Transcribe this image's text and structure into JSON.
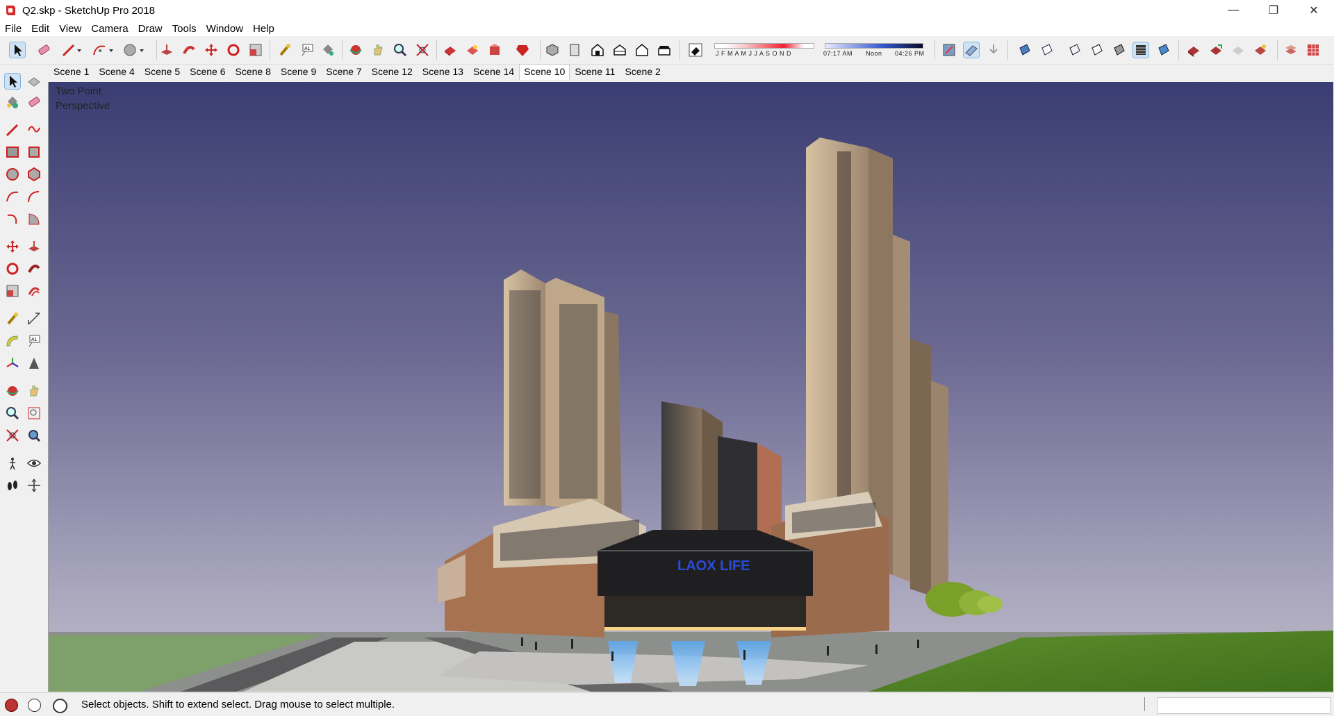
{
  "window": {
    "title": "Q2.skp - SketchUp Pro 2018",
    "controls": [
      "minimize-icon",
      "restore-icon",
      "close-icon"
    ]
  },
  "menu": [
    "File",
    "Edit",
    "View",
    "Camera",
    "Draw",
    "Tools",
    "Window",
    "Help"
  ],
  "shadows": {
    "months": "J F M A M J J A S O N D",
    "time_start": "07:17 AM",
    "time_mid": "Noon",
    "time_end": "04:26 PM"
  },
  "scenes": {
    "tabs": [
      "Scene 1",
      "Scene 4",
      "Scene 5",
      "Scene 6",
      "Scene 8",
      "Scene 9",
      "Scene 7",
      "Scene 12",
      "Scene 13",
      "Scene 14",
      "Scene 10",
      "Scene 11",
      "Scene 2"
    ],
    "active": "Scene 10"
  },
  "viewport": {
    "camera_label": "Two Point\nPerspective",
    "sign_text": "LAOX LIFE"
  },
  "status": {
    "message": "Select objects. Shift to extend select. Drag mouse to select multiple.",
    "measurements_value": ""
  },
  "colors": {
    "sky_top": "#3c3f73",
    "sky_bottom": "#b3b0c2",
    "grass": "#5a8a2a",
    "brick": "#8b5a42",
    "sign_blue": "#2a4bd8"
  }
}
